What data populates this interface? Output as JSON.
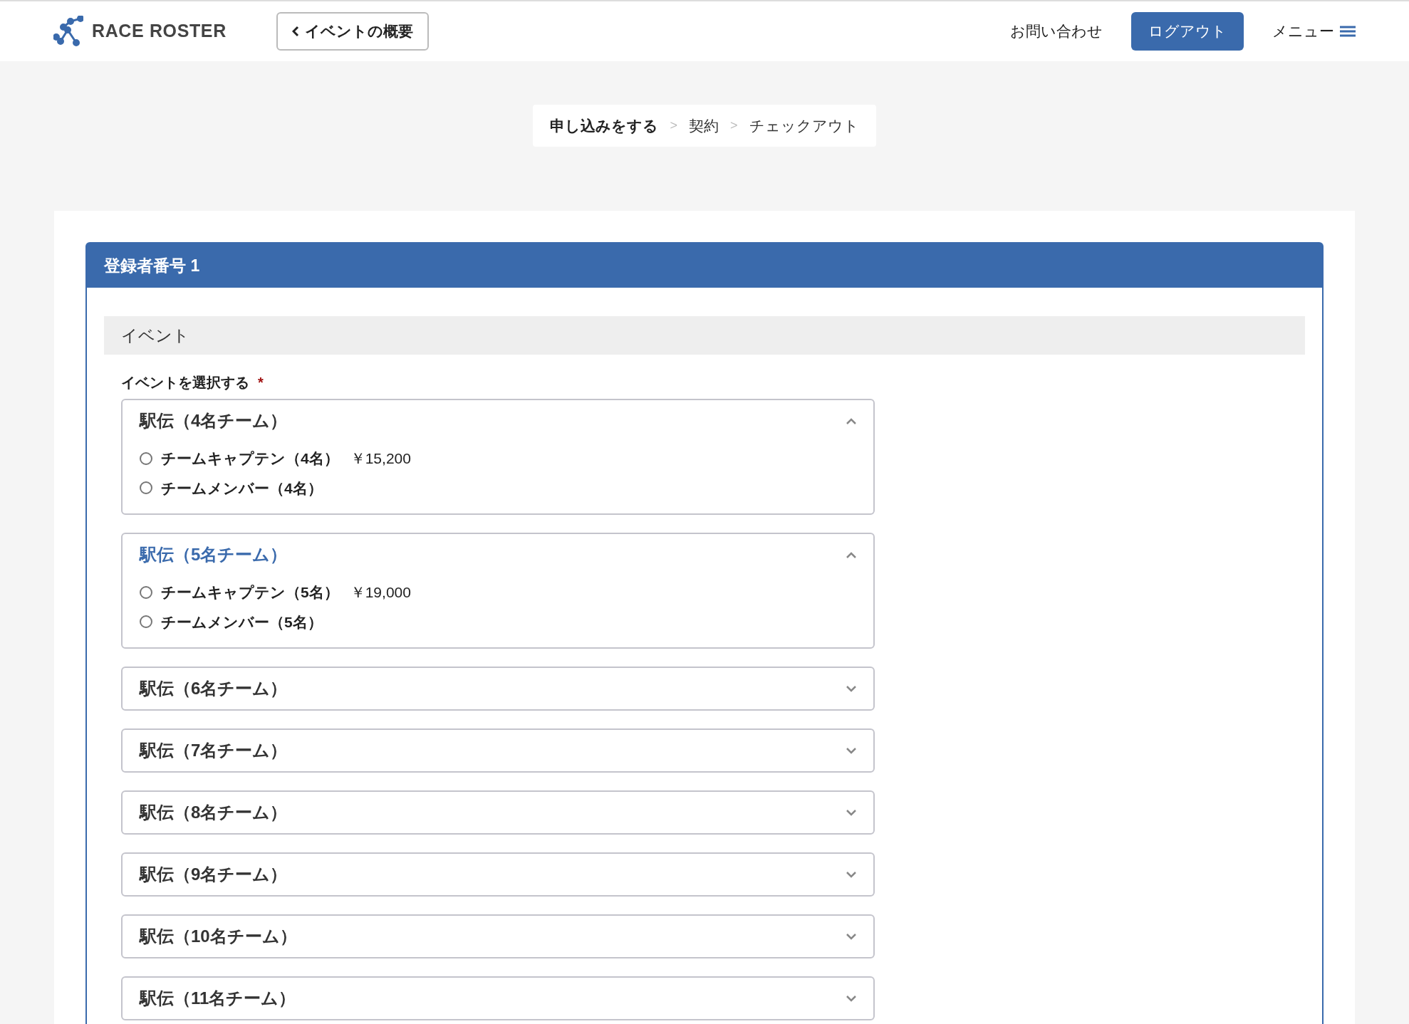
{
  "header": {
    "logo": "RACE ROSTER",
    "back_button": "イベントの概要",
    "contact_link": "お問い合わせ",
    "logout_button": "ログアウト",
    "menu_button": "メニュー"
  },
  "breadcrumb": [
    {
      "kind": "step",
      "label": "申し込みをする",
      "current": true
    },
    {
      "kind": "separator",
      "label": ">"
    },
    {
      "kind": "step",
      "label": "契約",
      "current": false
    },
    {
      "kind": "separator",
      "label": ">"
    },
    {
      "kind": "step",
      "label": "チェックアウト",
      "current": false
    }
  ],
  "registrant": {
    "title": "登録者番号 1",
    "section": "イベント",
    "field_label": "イベントを選択する",
    "required_mark": "*",
    "events": [
      {
        "title": "駅伝（4名チーム）",
        "expanded": true,
        "highlighted": false,
        "options": [
          {
            "label": "チームキャプテン（4名）",
            "price": "￥15,200",
            "selected": false
          },
          {
            "label": "チームメンバー（4名）",
            "selected": false
          }
        ]
      },
      {
        "title": "駅伝（5名チーム）",
        "expanded": true,
        "highlighted": true,
        "options": [
          {
            "label": "チームキャプテン（5名）",
            "price": "￥19,000",
            "selected": false
          },
          {
            "label": "チームメンバー（5名）",
            "selected": false
          }
        ]
      },
      {
        "title": "駅伝（6名チーム）",
        "expanded": false,
        "highlighted": false
      },
      {
        "title": "駅伝（7名チーム）",
        "expanded": false,
        "highlighted": false
      },
      {
        "title": "駅伝（8名チーム）",
        "expanded": false,
        "highlighted": false
      },
      {
        "title": "駅伝（9名チーム）",
        "expanded": false,
        "highlighted": false
      },
      {
        "title": "駅伝（10名チーム）",
        "expanded": false,
        "highlighted": false
      },
      {
        "title": "駅伝（11名チーム）",
        "expanded": false,
        "highlighted": false
      }
    ]
  }
}
